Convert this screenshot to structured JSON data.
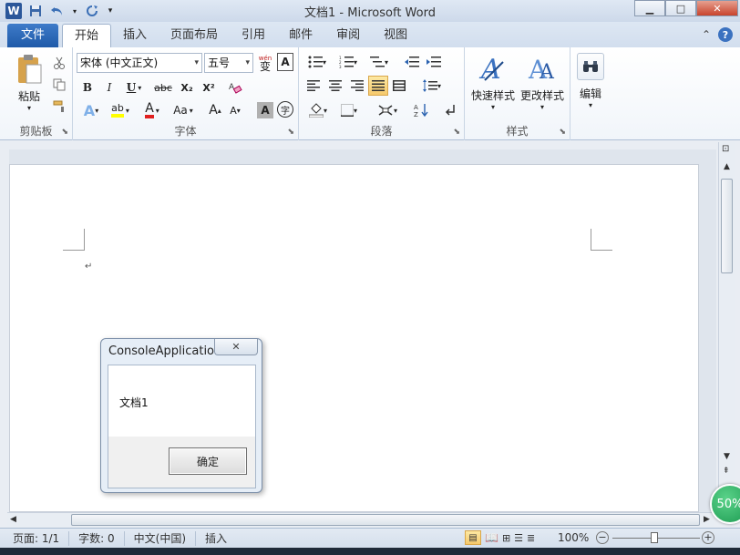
{
  "window": {
    "title": "文档1  -  Microsoft Word",
    "app_icon": "W",
    "minimize_glyph": "▁",
    "maximize_glyph": "□",
    "close_glyph": "✕"
  },
  "tabs": {
    "file": "文件",
    "items": [
      "开始",
      "插入",
      "页面布局",
      "引用",
      "邮件",
      "审阅",
      "视图"
    ],
    "active": "开始",
    "collapse_glyph": "⌃",
    "help_glyph": "?"
  },
  "ribbon": {
    "clipboard": {
      "label": "剪贴板",
      "paste": "粘贴"
    },
    "font": {
      "label": "字体",
      "font_name": "宋体 (中文正文)",
      "font_size": "五号",
      "bold": "B",
      "italic": "I",
      "underline": "U",
      "strike": "abc",
      "subscript": "X₂",
      "superscript": "X²",
      "highlight": "ab",
      "font_color": "A",
      "change_case": "Aa",
      "grow": "A",
      "shrink": "A",
      "char_shade": "A",
      "enclose": "字",
      "wen": "wén",
      "wen_char": "变"
    },
    "paragraph": {
      "label": "段落"
    },
    "styles": {
      "label": "样式",
      "quick": "快速样式",
      "change": "更改样式"
    },
    "editing": {
      "label": "编辑"
    }
  },
  "dialog": {
    "title": "ConsoleApplicatio...",
    "message": "文档1",
    "ok": "确定",
    "close_glyph": "✕"
  },
  "statusbar": {
    "page": "页面: 1/1",
    "words": "字数: 0",
    "language": "中文(中国)",
    "mode": "插入",
    "zoom": "100%"
  },
  "zoom_badge": "50%",
  "colors": {
    "accent": "#2b579a",
    "file_tab": "#2a66b8",
    "highlight_yellow": "#ffff00",
    "font_red": "#e02020"
  }
}
